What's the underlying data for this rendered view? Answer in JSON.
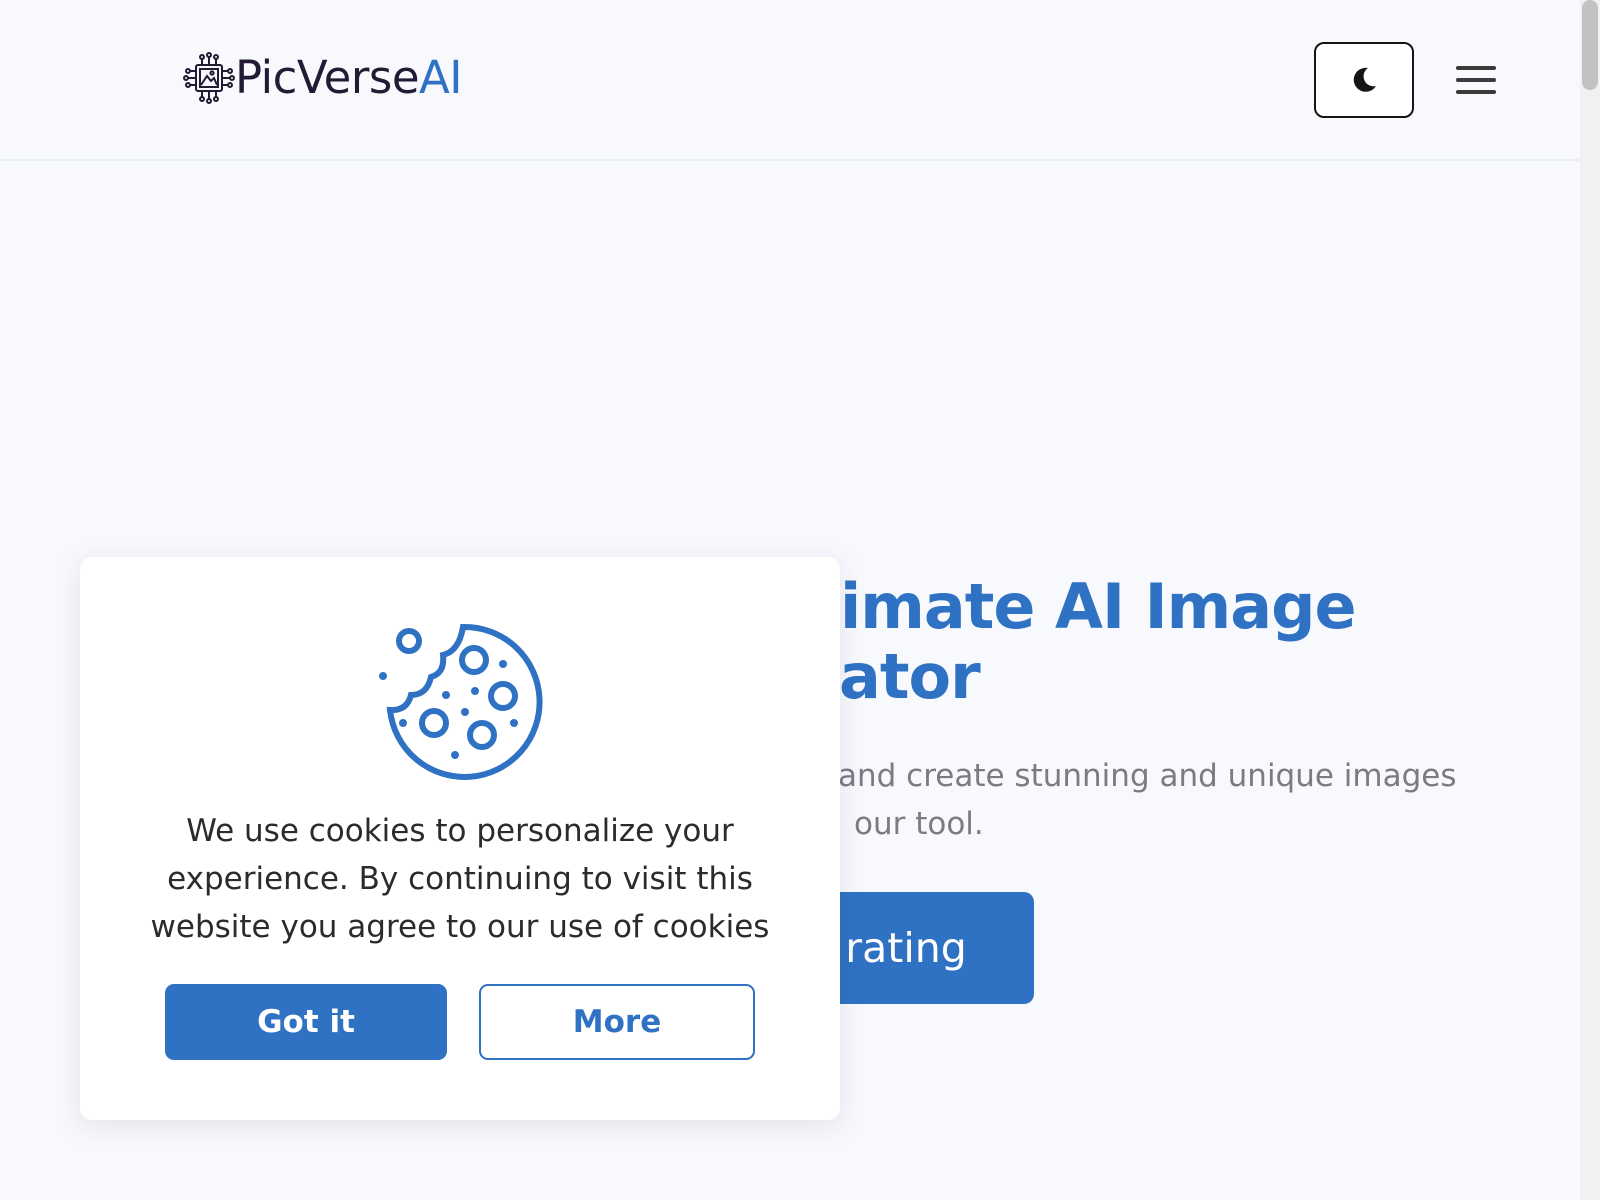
{
  "header": {
    "brand_name": "PicVerse",
    "brand_suffix": "AI",
    "logo_icon": "chip-image-icon",
    "theme_toggle_icon": "moon-icon",
    "menu_icon": "hamburger-menu-icon"
  },
  "hero": {
    "title_visible": "imate AI Image ator",
    "title_line1": "imate AI Image",
    "title_line2": "ator",
    "subtitle_line1": "and create stunning and unique images",
    "subtitle_line2": "our tool.",
    "cta_label": "rating"
  },
  "cookie_banner": {
    "icon": "cookie-icon",
    "message": "We use cookies to personalize your experience. By continuing to visit this website you agree to our use of cookies",
    "accept_label": "Got it",
    "more_label": "More"
  },
  "colors": {
    "accent": "#2f72c4",
    "brand_text": "#231a33",
    "page_bg": "#f8f9fd",
    "muted_text": "#7b7b84"
  }
}
